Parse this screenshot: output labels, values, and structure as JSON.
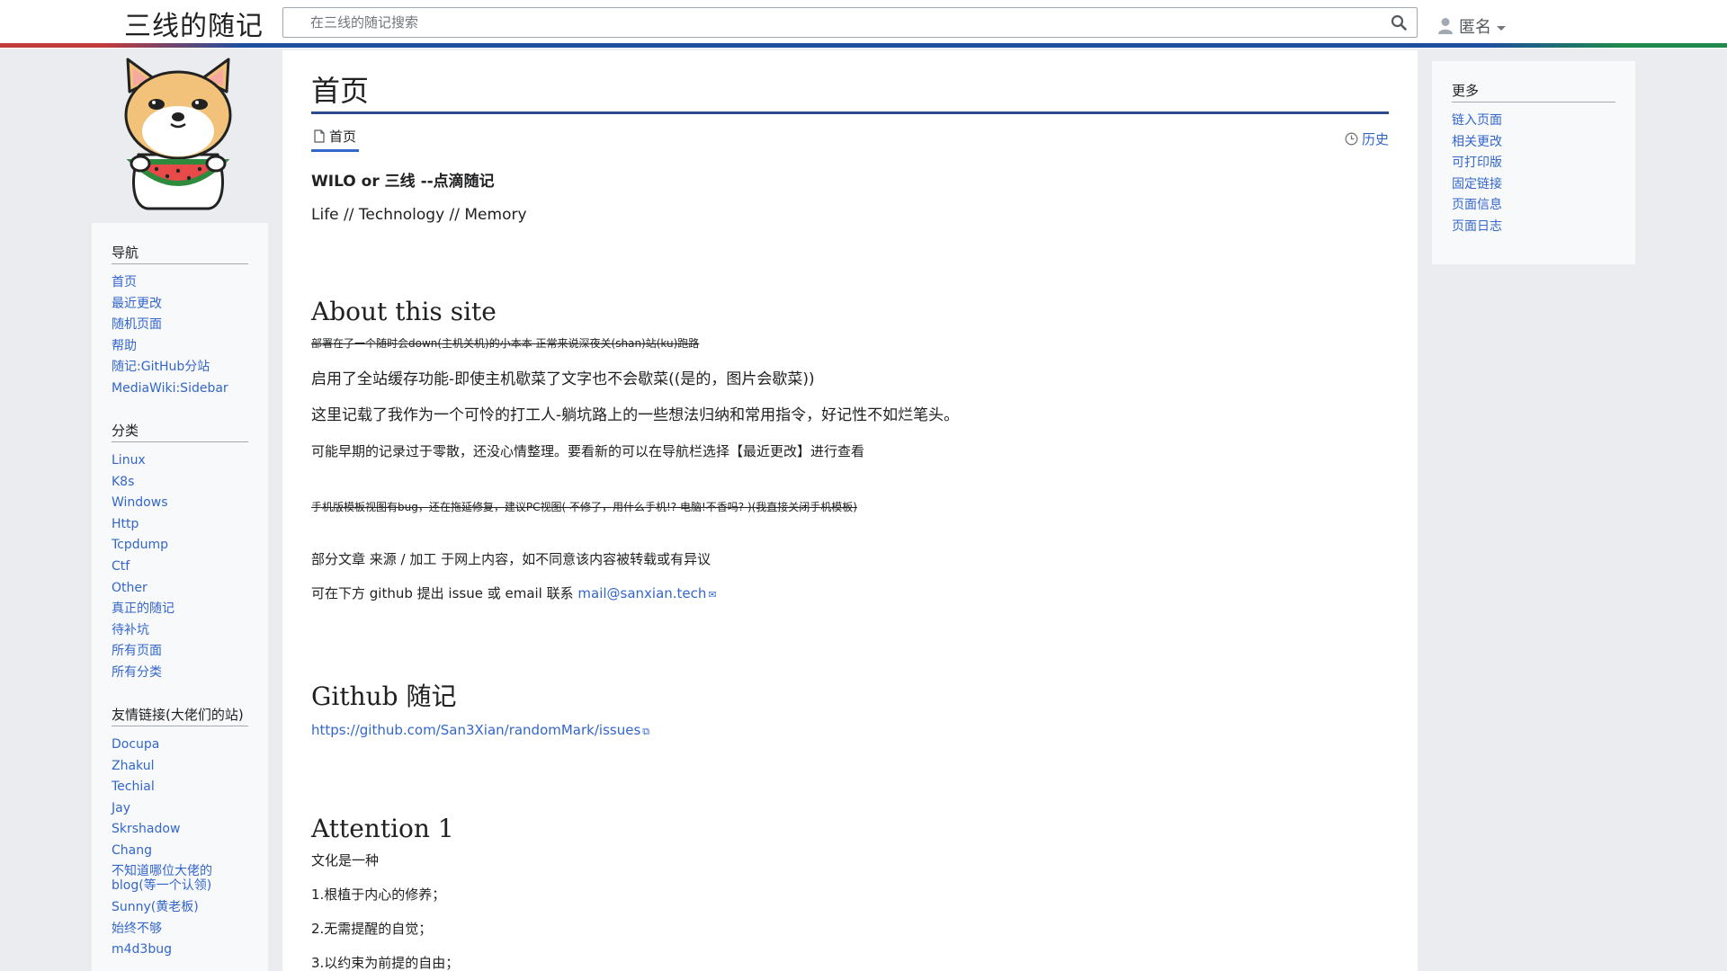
{
  "header": {
    "site_name": "三线的随记",
    "search_placeholder": "在三线的随记搜索",
    "user_name": "匿名"
  },
  "logo": {
    "alt": "shiba-dog-eating-watermelon"
  },
  "sidebar": {
    "sections": [
      {
        "title": "导航",
        "items": [
          "首页",
          "最近更改",
          "随机页面",
          "帮助",
          "随记:GitHub分站",
          "MediaWiki:Sidebar"
        ]
      },
      {
        "title": "分类",
        "items": [
          "Linux",
          "K8s",
          "Windows",
          "Http",
          "Tcpdump",
          "Ctf",
          "Other",
          "真正的随记",
          "待补坑",
          "所有页面",
          "所有分类"
        ]
      },
      {
        "title": "友情链接(大佬们的站)",
        "items": [
          "Docupa",
          "Zhakul",
          "Techial",
          "Jay",
          "Skrshadow",
          "Chang",
          "不知道哪位大佬的blog(等一个认领)",
          "Sunny(黄老板)",
          "始终不够",
          "m4d3bug"
        ]
      }
    ]
  },
  "content": {
    "title": "首页",
    "tab_page": "首页",
    "tab_history": "历史",
    "tagline_bold": "WILO or 三线 --点滴随记",
    "tagline": "Life // Technology // Memory",
    "about": {
      "heading": "About this site",
      "strike1": "部署在了一个随时会down(主机关机)的小本本 正常来说深夜关(shan)站(ku)跑路",
      "line1": "启用了全站缓存功能-即使主机歇菜了文字也不会歇菜((是的，图片会歇菜))",
      "line2": "这里记载了我作为一个可怜的打工人-躺坑路上的一些想法归纳和常用指令，好记性不如烂笔头。",
      "line3": "可能早期的记录过于零散，还没心情整理。要看新的可以在导航栏选择【最近更改】进行查看",
      "strike2": "手机版模板视图有bug，还在拖延修复，建议PC视图(  不修了，用什么手机!?  电脑!不香吗?  )(我直接关闭手机模板)",
      "line4": "部分文章 来源 / 加工 于网上内容，如不同意该内容被转载或有异议",
      "line5_prefix": "可在下方 github 提出 issue 或 email 联系 ",
      "email": "mail@sanxian.tech"
    },
    "github": {
      "heading": "Github 随记",
      "link": "https://github.com/San3Xian/randomMark/issues"
    },
    "attention": {
      "heading": "Attention 1",
      "lines": [
        "文化是一种",
        "1.根植于内心的修养；",
        "2.无需提醒的自觉；",
        "3.以约束为前提的自由；"
      ]
    }
  },
  "right": {
    "title": "更多",
    "items": [
      "链入页面",
      "相关更改",
      "可打印版",
      "固定链接",
      "页面信息",
      "页面日志"
    ]
  }
}
